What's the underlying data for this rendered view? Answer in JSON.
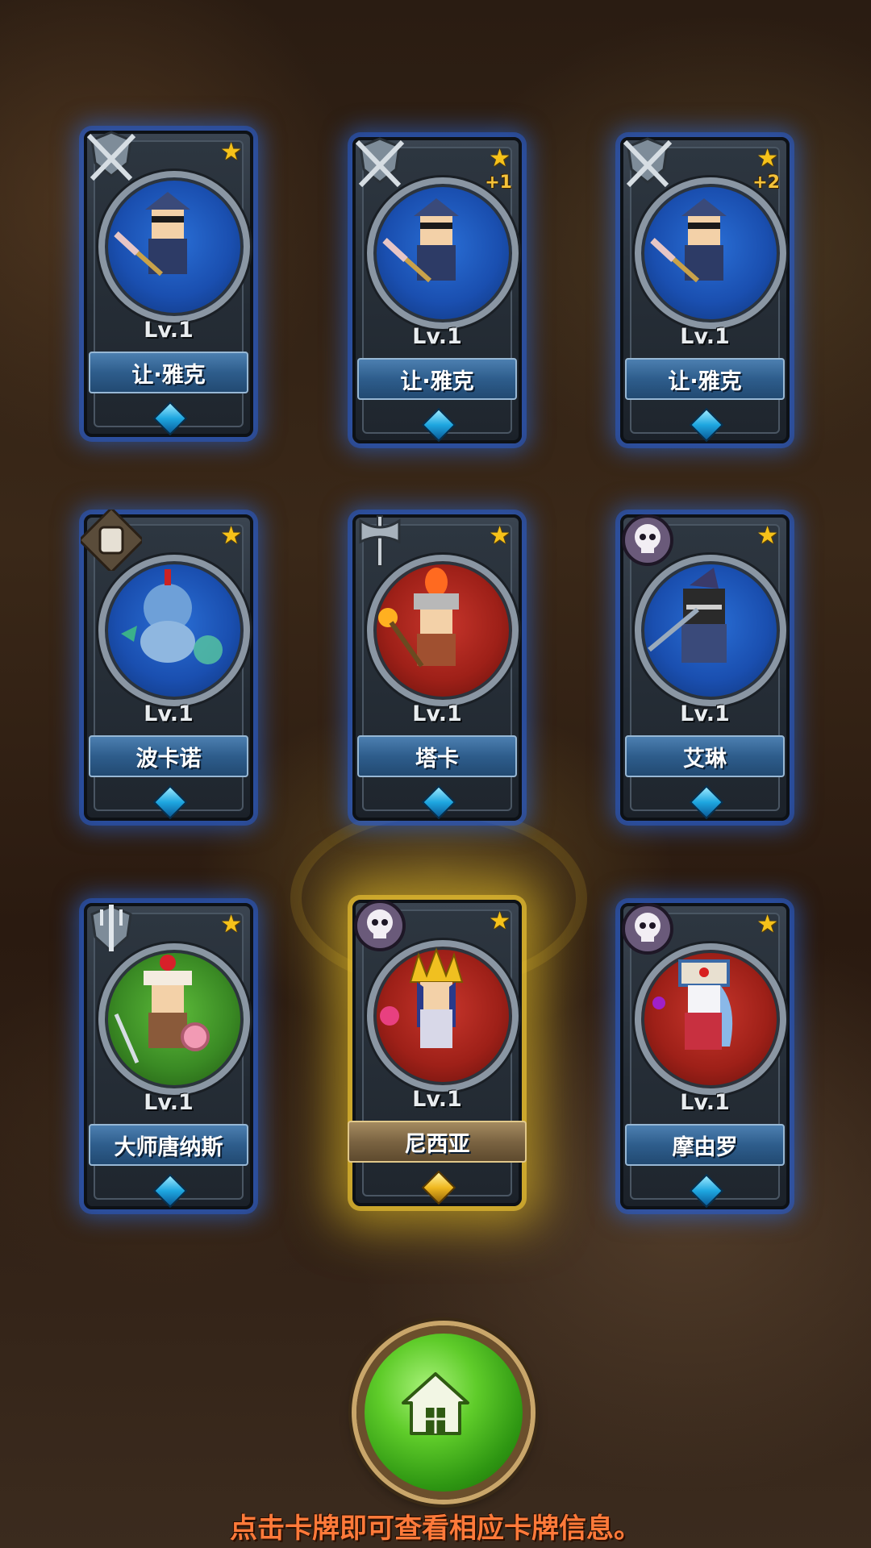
{
  "cards": [
    {
      "level": "Lv.1",
      "name": "让·雅克",
      "stars": "★",
      "plus": "",
      "class_icon": "crossed-swords-shield-icon",
      "portrait": "blue"
    },
    {
      "level": "Lv.1",
      "name": "让·雅克",
      "stars": "★",
      "plus": "+1",
      "class_icon": "crossed-swords-shield-icon",
      "portrait": "blue"
    },
    {
      "level": "Lv.1",
      "name": "让·雅克",
      "stars": "★",
      "plus": "+2",
      "class_icon": "crossed-swords-shield-icon",
      "portrait": "blue"
    },
    {
      "level": "Lv.1",
      "name": "波卡诺",
      "stars": "★",
      "plus": "",
      "class_icon": "fist-icon",
      "portrait": "blue"
    },
    {
      "level": "Lv.1",
      "name": "塔卡",
      "stars": "★",
      "plus": "",
      "class_icon": "axe-icon",
      "portrait": "red"
    },
    {
      "level": "Lv.1",
      "name": "艾琳",
      "stars": "★",
      "plus": "",
      "class_icon": "skull-icon",
      "portrait": "blue"
    },
    {
      "level": "Lv.1",
      "name": "大师唐纳斯",
      "stars": "★",
      "plus": "",
      "class_icon": "trident-icon",
      "portrait": "green"
    },
    {
      "level": "Lv.1",
      "name": "尼西亚",
      "stars": "★",
      "plus": "",
      "class_icon": "skull-icon",
      "portrait": "red"
    },
    {
      "level": "Lv.1",
      "name": "摩由罗",
      "stars": "★",
      "plus": "",
      "class_icon": "skull-icon",
      "portrait": "red"
    }
  ],
  "home_button": {
    "icon": "home-icon"
  },
  "hint": "点击卡牌即可查看相应卡牌信息。",
  "colors": {
    "frame_glow": "#2a6ee6",
    "highlight_glow": "#f0c828",
    "hint_text": "#ff7a3a",
    "home_button": "#5fcc2a"
  }
}
